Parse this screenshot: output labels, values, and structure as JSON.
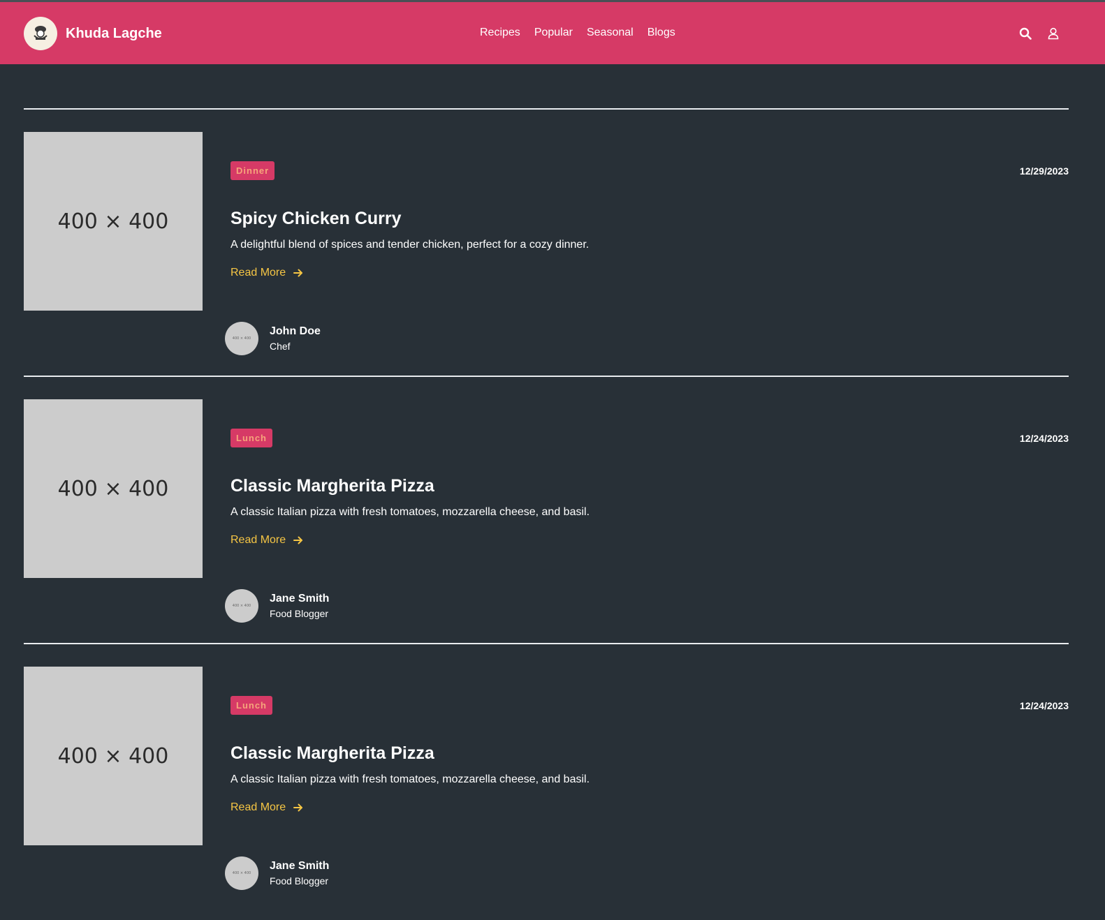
{
  "brand": {
    "name": "Khuda Lagche",
    "logo_icon": "chef-logo-icon"
  },
  "nav": {
    "items": [
      "Recipes",
      "Popular",
      "Seasonal",
      "Blogs"
    ]
  },
  "header_icons": [
    "search-icon",
    "user-icon"
  ],
  "colors": {
    "header_bg": "#d63a66",
    "page_bg": "#283037",
    "accent_link": "#f5c544",
    "badge_text": "#f6a57b"
  },
  "posts": [
    {
      "image_label": "400 × 400",
      "category": "Dinner",
      "date": "12/29/2023",
      "title": "Spicy Chicken Curry",
      "description": "A delightful blend of spices and tender chicken, perfect for a cozy dinner.",
      "read_more": "Read More",
      "author": {
        "name": "John Doe",
        "role": "Chef",
        "avatar_label": "400 × 400"
      }
    },
    {
      "image_label": "400 × 400",
      "category": "Lunch",
      "date": "12/24/2023",
      "title": "Classic Margherita Pizza",
      "description": "A classic Italian pizza with fresh tomatoes, mozzarella cheese, and basil.",
      "read_more": "Read More",
      "author": {
        "name": "Jane Smith",
        "role": "Food Blogger",
        "avatar_label": "400 × 400"
      }
    },
    {
      "image_label": "400 × 400",
      "category": "Lunch",
      "date": "12/24/2023",
      "title": "Classic Margherita Pizza",
      "description": "A classic Italian pizza with fresh tomatoes, mozzarella cheese, and basil.",
      "read_more": "Read More",
      "author": {
        "name": "Jane Smith",
        "role": "Food Blogger",
        "avatar_label": "400 × 400"
      }
    }
  ]
}
